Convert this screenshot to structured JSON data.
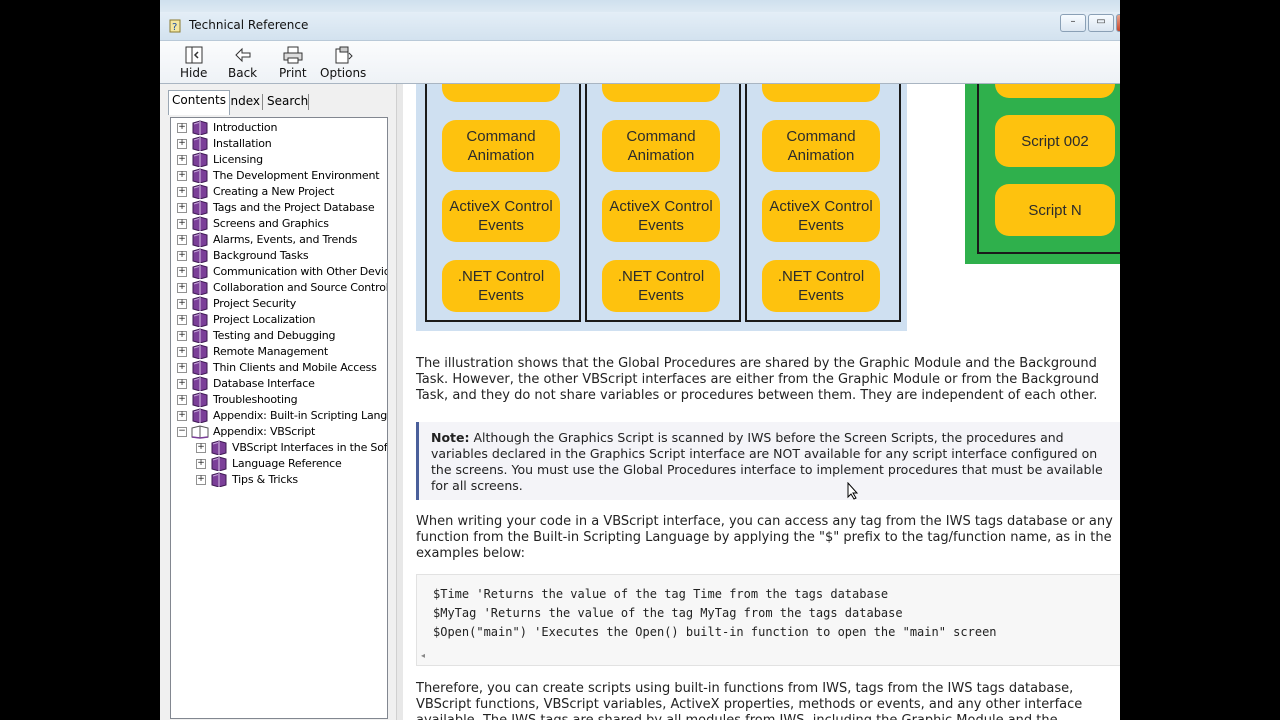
{
  "window": {
    "title": "Technical Reference",
    "controls": [
      "–",
      "▭",
      "✕"
    ]
  },
  "toolbar": [
    {
      "label": "Hide",
      "icon": "hide-icon"
    },
    {
      "label": "Back",
      "icon": "back-arrow-icon"
    },
    {
      "label": "Print",
      "icon": "printer-icon"
    },
    {
      "label": "Options",
      "icon": "options-icon"
    }
  ],
  "tabs": [
    {
      "label": "Contents",
      "active": true
    },
    {
      "label": "Index",
      "active": false
    },
    {
      "label": "Search",
      "active": false
    }
  ],
  "tree": [
    {
      "label": "Introduction",
      "level": 0,
      "expanded": false
    },
    {
      "label": "Installation",
      "level": 0,
      "expanded": false
    },
    {
      "label": "Licensing",
      "level": 0,
      "expanded": false
    },
    {
      "label": "The Development Environment",
      "level": 0,
      "expanded": false
    },
    {
      "label": "Creating a New Project",
      "level": 0,
      "expanded": false
    },
    {
      "label": "Tags and the Project Database",
      "level": 0,
      "expanded": false
    },
    {
      "label": "Screens and Graphics",
      "level": 0,
      "expanded": false
    },
    {
      "label": "Alarms, Events, and Trends",
      "level": 0,
      "expanded": false
    },
    {
      "label": "Background Tasks",
      "level": 0,
      "expanded": false
    },
    {
      "label": "Communication with Other Devices",
      "level": 0,
      "expanded": false
    },
    {
      "label": "Collaboration and Source Control",
      "level": 0,
      "expanded": false
    },
    {
      "label": "Project Security",
      "level": 0,
      "expanded": false
    },
    {
      "label": "Project Localization",
      "level": 0,
      "expanded": false
    },
    {
      "label": "Testing and Debugging",
      "level": 0,
      "expanded": false
    },
    {
      "label": "Remote Management",
      "level": 0,
      "expanded": false
    },
    {
      "label": "Thin Clients and Mobile Access",
      "level": 0,
      "expanded": false
    },
    {
      "label": "Database Interface",
      "level": 0,
      "expanded": false
    },
    {
      "label": "Troubleshooting",
      "level": 0,
      "expanded": false
    },
    {
      "label": "Appendix: Built-in Scripting Languag",
      "level": 0,
      "expanded": false
    },
    {
      "label": "Appendix: VBScript",
      "level": 0,
      "expanded": true
    },
    {
      "label": "VBScript Interfaces in the Softw",
      "level": 1,
      "expanded": false
    },
    {
      "label": "Language Reference",
      "level": 1,
      "expanded": false
    },
    {
      "label": "Tips & Tricks",
      "level": 1,
      "expanded": false
    }
  ],
  "diagram": {
    "columns": [
      [
        "Command\nAnimation",
        "ActiveX Control\nEvents",
        ".NET Control\nEvents"
      ],
      [
        "Command\nAnimation",
        "ActiveX Control\nEvents",
        ".NET Control\nEvents"
      ],
      [
        "Command\nAnimation",
        "ActiveX Control\nEvents",
        ".NET Control\nEvents"
      ]
    ],
    "scripts": [
      "Script 002",
      "Script N"
    ],
    "colors": {
      "pill": "#fec20e",
      "panel": "#cfe0f1",
      "green": "#2fb04c"
    }
  },
  "content": {
    "para1": "The illustration shows that the Global Procedures are shared by the Graphic Module and the Background Task. However, the other VBScript interfaces are either from the Graphic Module or from the Background Task, and they do not share variables or procedures between them. They are independent of each other.",
    "note_label": "Note:",
    "note_text": " Although the Graphics Script is scanned by IWS before the Screen Scripts, the procedures and variables declared in the Graphics Script interface are NOT available for any script interface configured on the screens. You must use the Global Procedures interface to implement procedures that must be available for all screens.",
    "para2": "When writing your code in a VBScript interface, you can access any tag from the IWS tags database or any function from the Built-in Scripting Language by applying the \"$\" prefix to the tag/function name, as in the examples below:",
    "code": [
      "$Time 'Returns the value of the tag Time from the tags database",
      "$MyTag 'Returns the value of the tag MyTag from the tags database",
      "$Open(\"main\") 'Executes the Open() built-in function to open the \"main\" screen"
    ],
    "para3": "Therefore, you can create scripts using built-in functions from IWS, tags from the IWS tags database, VBScript functions, VBScript variables, ActiveX properties, methods or events, and any other interface available. The IWS tags are shared by all modules from IWS, including the Graphic Module and the"
  }
}
